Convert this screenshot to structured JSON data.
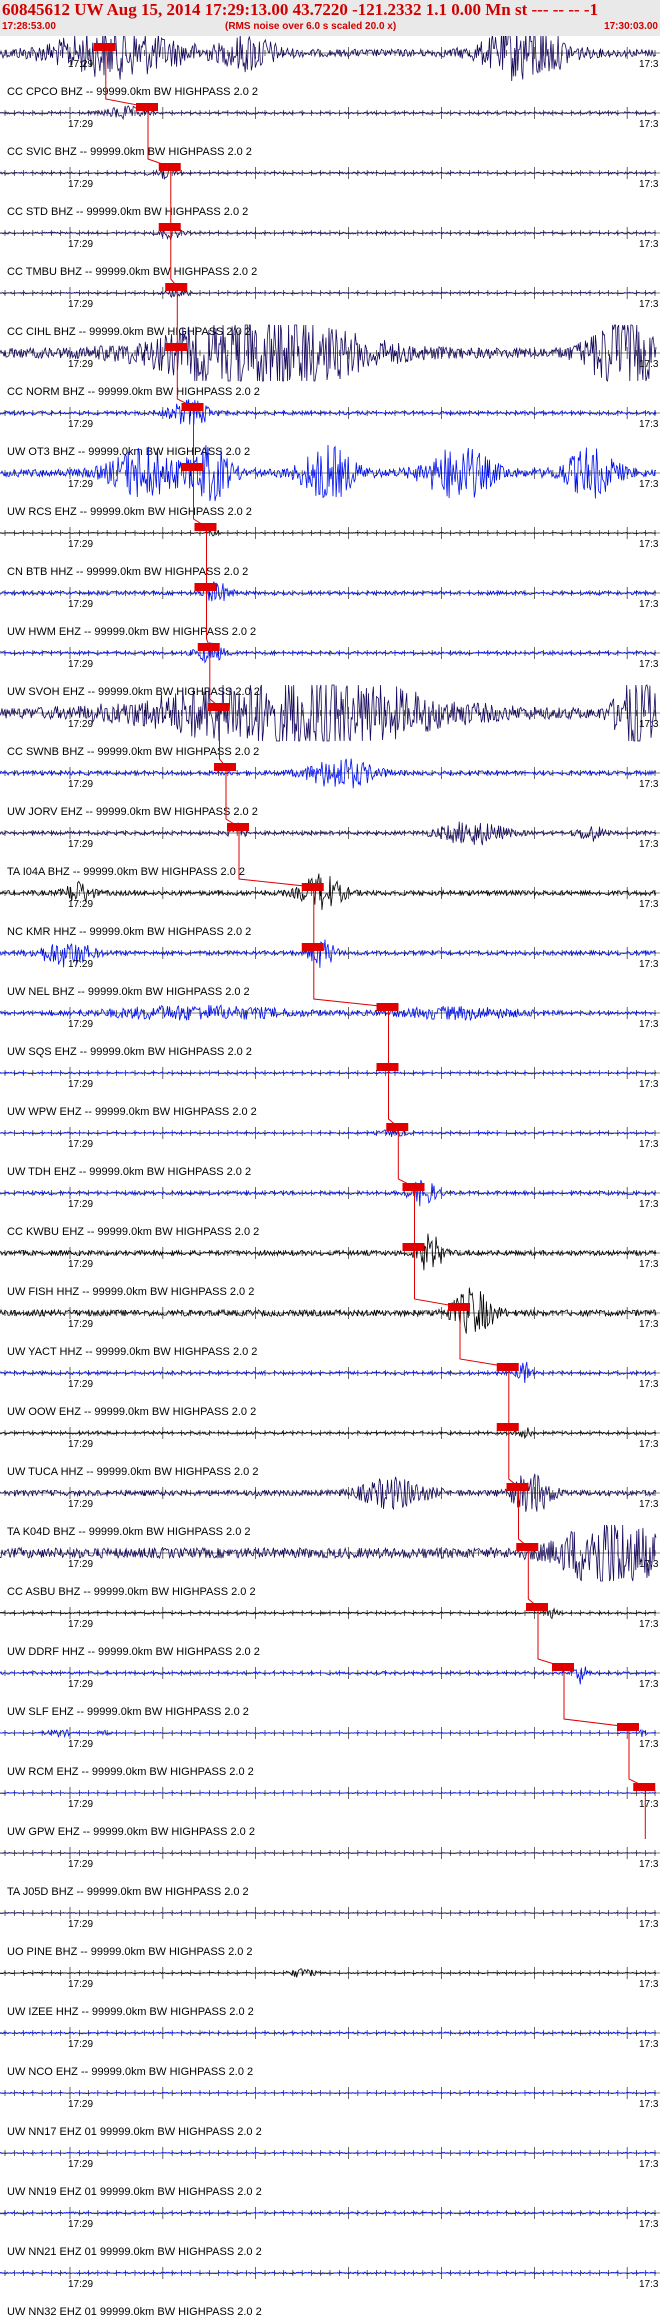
{
  "header": {
    "title": "60845612 UW Aug 15, 2014 17:29:13.00   43.7220 -121.2332  1.1 0.00 Mn st --- -- -- -1",
    "start_time": "17:28:53.00",
    "note": "(RMS noise over 6.0 s scaled 20.0 x)",
    "end_time": "17:30:03.00"
  },
  "colors": {
    "header_bg": "#e9e9e9",
    "header_text": "#d00000",
    "trace_navy": "#1a0a5e",
    "trace_blue": "#0010ee",
    "trace_black": "#000000",
    "pick": "#e00000"
  },
  "time_label": "17:29",
  "right_edge_label": "17:3",
  "traces": [
    {
      "label": "CC CPCO BHZ -- 99999.0km BW  HIGHPASS  2.0  2",
      "color": "navy",
      "amp": 22,
      "events": [
        [
          0.18,
          0.1,
          0.8
        ],
        [
          0.38,
          0.04,
          0.6
        ],
        [
          0.8,
          0.06,
          1.0
        ]
      ],
      "pick": 0.155
    },
    {
      "label": "CC SVIC BHZ -- 99999.0km BW  HIGHPASS  2.0  2",
      "color": "navy",
      "amp": 7,
      "events": [
        [
          0.19,
          0.03,
          0.7
        ]
      ],
      "pick": 0.22
    },
    {
      "label": "CC STD BHZ -- 99999.0km BW  HIGHPASS  2.0  2",
      "color": "navy",
      "amp": 6,
      "events": [
        [
          0.25,
          0.02,
          0.8
        ]
      ],
      "pick": 0.255
    },
    {
      "label": "CC TMBU BHZ -- 99999.0km BW  HIGHPASS  2.0  2",
      "color": "navy",
      "amp": 6,
      "events": [
        [
          0.26,
          0.02,
          0.7
        ]
      ],
      "pick": 0.255
    },
    {
      "label": "CC CIHL BHZ -- 99999.0km BW  HIGHPASS  2.0  2",
      "color": "navy",
      "amp": 5,
      "events": [
        [
          0.27,
          0.02,
          0.6
        ]
      ],
      "pick": 0.265
    },
    {
      "label": "CC NORM BHZ -- 99999.0km BW  HIGHPASS  2.0  2",
      "color": "navy",
      "amp": 30,
      "events": [
        [
          0.4,
          0.15,
          1.0
        ],
        [
          0.95,
          0.05,
          1.0
        ]
      ],
      "pick": 0.265
    },
    {
      "label": "UW OT3 BHZ -- 99999.0km BW  HIGHPASS  2.0  2",
      "color": "blue",
      "amp": 10,
      "events": [
        [
          0.29,
          0.03,
          1.0
        ]
      ],
      "pick": 0.29
    },
    {
      "label": "UW RCS EHZ -- 99999.0km BW  HIGHPASS  2.0  2",
      "color": "blue",
      "amp": 22,
      "events": [
        [
          0.22,
          0.05,
          0.9
        ],
        [
          0.32,
          0.03,
          1.0
        ],
        [
          0.5,
          0.04,
          0.9
        ],
        [
          0.7,
          0.05,
          0.9
        ],
        [
          0.9,
          0.04,
          0.8
        ]
      ],
      "pick": 0.29
    },
    {
      "label": "CN BTB HHZ -- 99999.0km BW  HIGHPASS  2.0  2",
      "color": "black",
      "amp": 3,
      "events": [
        [
          0.325,
          0.01,
          0.8
        ]
      ],
      "pick": 0.31
    },
    {
      "label": "UW HWM EHZ -- 99999.0km BW  HIGHPASS  2.0  2",
      "color": "blue",
      "amp": 10,
      "events": [
        [
          0.33,
          0.02,
          0.8
        ]
      ],
      "pick": 0.31
    },
    {
      "label": "UW SVOH EHZ -- 99999.0km BW  HIGHPASS  2.0  2",
      "color": "blue",
      "amp": 9,
      "events": [
        [
          0.32,
          0.02,
          0.9
        ]
      ],
      "pick": 0.315
    },
    {
      "label": "CC SWNB BHZ -- 99999.0km BW  HIGHPASS  2.0  2",
      "color": "navy",
      "amp": 30,
      "events": [
        [
          0.45,
          0.2,
          1.0
        ],
        [
          0.97,
          0.03,
          1.0
        ]
      ],
      "pick": 0.33
    },
    {
      "label": "UW JORV EHZ -- 99999.0km BW  HIGHPASS  2.0  2",
      "color": "blue",
      "amp": 12,
      "events": [
        [
          0.52,
          0.05,
          1.0
        ]
      ],
      "pick": 0.34
    },
    {
      "label": "TA I04A BHZ -- 99999.0km BW  HIGHPASS  2.0  2",
      "color": "navy",
      "amp": 10,
      "events": [
        [
          0.36,
          0.01,
          0.9
        ],
        [
          0.72,
          0.05,
          0.9
        ],
        [
          0.9,
          0.02,
          0.6
        ]
      ],
      "pick": 0.36
    },
    {
      "label": "NC KMR HHZ -- 99999.0km BW  HIGHPASS  2.0  2",
      "color": "black",
      "amp": 14,
      "events": [
        [
          0.49,
          0.03,
          1.0
        ],
        [
          0.12,
          0.02,
          0.6
        ]
      ],
      "pick": 0.475
    },
    {
      "label": "UW NEL BHZ -- 99999.0km BW  HIGHPASS  2.0  2",
      "color": "blue",
      "amp": 12,
      "events": [
        [
          0.1,
          0.04,
          0.8
        ],
        [
          0.49,
          0.02,
          0.9
        ]
      ],
      "pick": 0.475
    },
    {
      "label": "UW SQS EHZ -- 99999.0km BW  HIGHPASS  2.0  2",
      "color": "blue",
      "amp": 9,
      "events": [
        [
          0.3,
          0.15,
          0.6
        ],
        [
          0.7,
          0.1,
          0.5
        ]
      ],
      "pick": 0.59
    },
    {
      "label": "UW WPW EHZ -- 99999.0km BW  HIGHPASS  2.0  2",
      "color": "blue",
      "amp": 6,
      "events": [],
      "pick": 0.59
    },
    {
      "label": "UW TDH EHZ -- 99999.0km BW  HIGHPASS  2.0  2",
      "color": "blue",
      "amp": 6,
      "events": [
        [
          0.6,
          0.02,
          0.5
        ]
      ],
      "pick": 0.605
    },
    {
      "label": "CC KWBU EHZ -- 99999.0km BW  HIGHPASS  2.0  2",
      "color": "blue",
      "amp": 10,
      "events": [
        [
          0.645,
          0.02,
          1.0
        ]
      ],
      "pick": 0.63
    },
    {
      "label": "UW FISH HHZ -- 99999.0km BW  HIGHPASS  2.0  2",
      "color": "black",
      "amp": 14,
      "events": [
        [
          0.655,
          0.02,
          1.0
        ]
      ],
      "pick": 0.63
    },
    {
      "label": "UW YACT HHZ -- 99999.0km BW  HIGHPASS  2.0  2",
      "color": "black",
      "amp": 18,
      "events": [
        [
          0.72,
          0.03,
          1.0
        ]
      ],
      "pick": 0.7
    },
    {
      "label": "UW OOW EHZ -- 99999.0km BW  HIGHPASS  2.0  2",
      "color": "blue",
      "amp": 9,
      "events": [
        [
          0.8,
          0.01,
          1.0
        ]
      ],
      "pick": 0.775
    },
    {
      "label": "UW TUCA HHZ -- 99999.0km BW  HIGHPASS  2.0  2",
      "color": "black",
      "amp": 8,
      "events": [
        [
          0.8,
          0.01,
          0.8
        ]
      ],
      "pick": 0.775
    },
    {
      "label": "TA K04D BHZ -- 99999.0km BW  HIGHPASS  2.0  2",
      "color": "navy",
      "amp": 16,
      "events": [
        [
          0.81,
          0.03,
          1.0
        ],
        [
          0.6,
          0.05,
          0.7
        ]
      ],
      "pick": 0.79
    },
    {
      "label": "CC ASBU BHZ -- 99999.0km BW  HIGHPASS  2.0  2",
      "color": "navy",
      "amp": 30,
      "events": [
        [
          0.93,
          0.07,
          1.0
        ]
      ],
      "pick": 0.805
    },
    {
      "label": "UW DDRF HHZ -- 99999.0km BW  HIGHPASS  2.0  2",
      "color": "black",
      "amp": 6,
      "events": [
        [
          0.84,
          0.01,
          0.6
        ]
      ],
      "pick": 0.82
    },
    {
      "label": "UW SLF EHZ -- 99999.0km BW  HIGHPASS  2.0  2",
      "color": "blue",
      "amp": 8,
      "events": [
        [
          0.885,
          0.01,
          1.0
        ]
      ],
      "pick": 0.86
    },
    {
      "label": "UW RCM EHZ -- 99999.0km BW  HIGHPASS  2.0  2",
      "color": "blue",
      "amp": 3,
      "events": [
        [
          0.09,
          0.02,
          1.0
        ],
        [
          0.16,
          0.01,
          0.6
        ],
        [
          0.98,
          0.005,
          1.0
        ]
      ],
      "pick": 0.96
    },
    {
      "label": "UW GPW EHZ -- 99999.0km BW  HIGHPASS  2.0  2",
      "color": "blue",
      "amp": 3,
      "events": [],
      "pick": 0.985
    },
    {
      "label": "TA J05D BHZ -- 99999.0km BW  HIGHPASS  2.0  2",
      "color": "navy",
      "amp": 3,
      "events": [],
      "pick": null
    },
    {
      "label": "UO PINE BHZ -- 99999.0km BW  HIGHPASS  2.0  2",
      "color": "navy",
      "amp": 3,
      "events": [],
      "pick": null
    },
    {
      "label": "UW IZEE HHZ -- 99999.0km BW  HIGHPASS  2.0  2",
      "color": "black",
      "amp": 4,
      "events": [
        [
          0.46,
          0.02,
          0.9
        ]
      ],
      "pick": null
    },
    {
      "label": "UW NCO EHZ -- 99999.0km BW  HIGHPASS  2.0  2",
      "color": "blue",
      "amp": 6,
      "events": [],
      "pick": null
    },
    {
      "label": "UW NN17 EHZ 01 99999.0km BW  HIGHPASS  2.0  2",
      "color": "blue",
      "amp": 4,
      "events": [],
      "pick": null
    },
    {
      "label": "UW NN19 EHZ 01 99999.0km BW  HIGHPASS  2.0  2",
      "color": "blue",
      "amp": 4,
      "events": [],
      "pick": null
    },
    {
      "label": "UW NN21 EHZ 01 99999.0km BW  HIGHPASS  2.0  2",
      "color": "blue",
      "amp": 6,
      "events": [],
      "pick": null
    },
    {
      "label": "UW NN32 EHZ 01 99999.0km BW  HIGHPASS  2.0  2",
      "color": "blue",
      "amp": 5,
      "events": [],
      "pick": null
    }
  ]
}
